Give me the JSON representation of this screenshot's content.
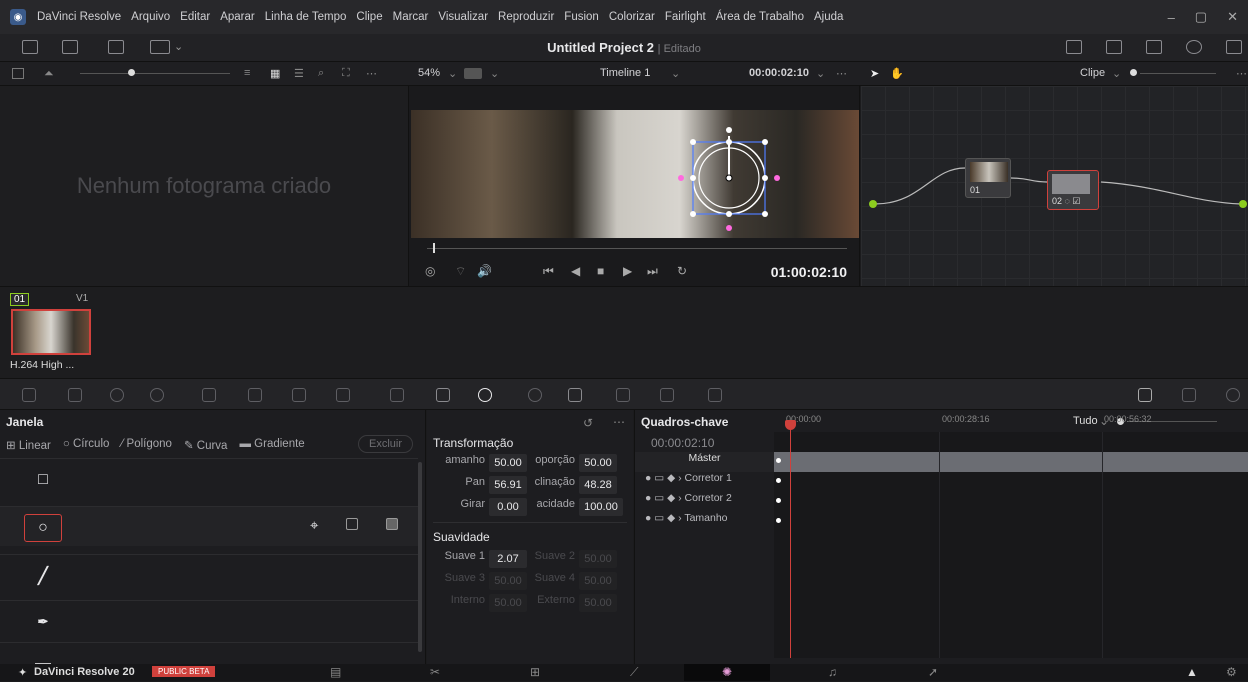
{
  "menubar": {
    "items": [
      "DaVinci Resolve",
      "Arquivo",
      "Editar",
      "Aparar",
      "Linha de Tempo",
      "Clipe",
      "Marcar",
      "Visualizar",
      "Reproduzir",
      "Fusion",
      "Colorizar",
      "Fairlight",
      "Área de Trabalho",
      "Ajuda"
    ]
  },
  "project": {
    "title": "Untitled Project 2",
    "status": "Editado"
  },
  "viewer": {
    "zoom": "54%",
    "timeline": "Timeline 1",
    "timecode": "00:00:02:10",
    "playhead_tc": "01:00:02:10"
  },
  "nodes_header": {
    "mode": "Clipe"
  },
  "gallery": {
    "empty_message": "Nenhum fotograma criado"
  },
  "clip": {
    "index": "01",
    "track": "V1",
    "codec": "H.264 High ..."
  },
  "window_panel": {
    "title": "Janela",
    "tabs": [
      "Linear",
      "Círculo",
      "Polígono",
      "Curva",
      "Gradiente"
    ],
    "delete_label": "Excluir"
  },
  "transform": {
    "title": "Transformação",
    "tamanho_label": "amanho",
    "tamanho": "50.00",
    "proporcao_label": "oporção",
    "proporcao": "50.00",
    "pan_label": "Pan",
    "pan": "56.91",
    "inclinacao_label": "clinação",
    "inclinacao": "48.28",
    "girar_label": "Girar",
    "girar": "0.00",
    "opacidade_label": "acidade",
    "opacidade": "100.00",
    "soft_title": "Suavidade",
    "suave1_label": "Suave 1",
    "suave1": "2.07",
    "suave2_label": "Suave 2",
    "suave2": "50.00",
    "suave3_label": "Suave 3",
    "suave3": "50.00",
    "suave4_label": "Suave 4",
    "suave4": "50.00",
    "interno_label": "Interno",
    "interno": "50.00",
    "externo_label": "Externo",
    "externo": "50.00"
  },
  "keyframes": {
    "title": "Quadros-chave",
    "filter": "Tudo",
    "timecode": "00:00:02:10",
    "ruler": [
      "00:00:00",
      "00:00:28:16",
      "00:00:56:32"
    ],
    "rows": [
      "Máster",
      "Corretor 1",
      "Corretor 2",
      "Tamanho"
    ]
  },
  "footer": {
    "app": "DaVinci Resolve 20",
    "badge": "PUBLIC BETA"
  },
  "colors": {
    "accent": "#d0413c",
    "node_green": "#8ccc1f",
    "handle_blue": "#4f7cff"
  }
}
